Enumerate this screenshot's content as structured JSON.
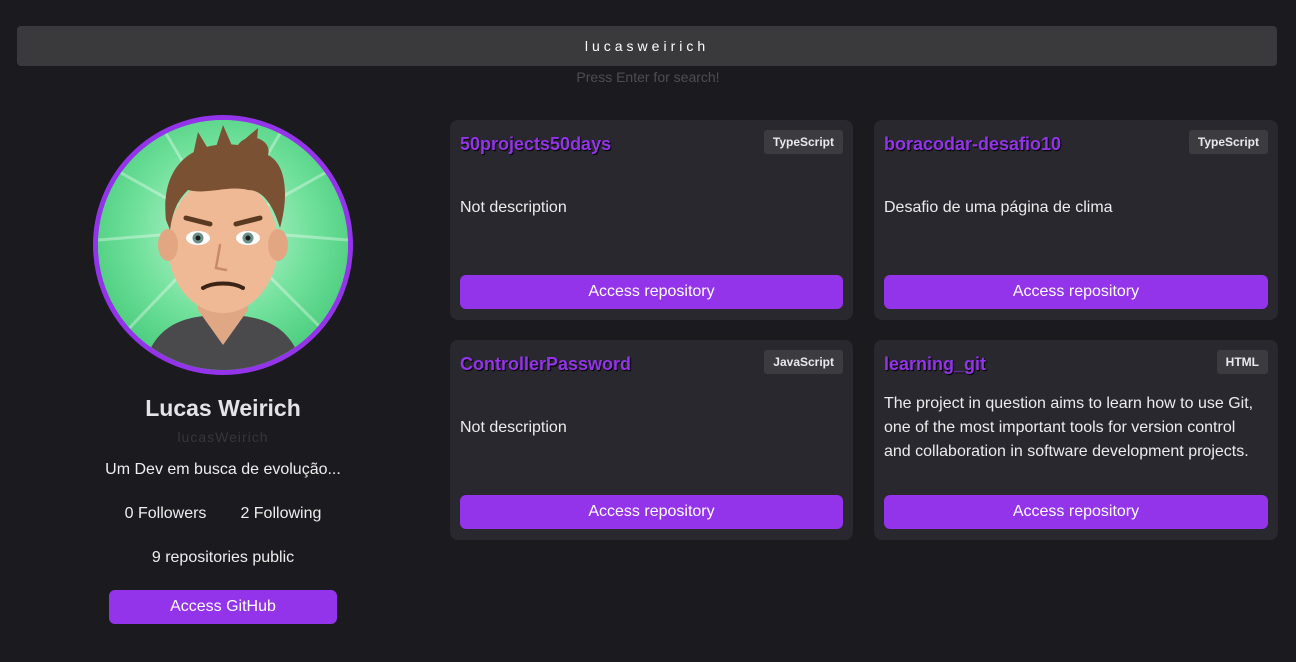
{
  "search": {
    "value": "lucasweirich",
    "hint": "Press Enter for search!"
  },
  "profile": {
    "name": "Lucas Weirich",
    "login": "lucasWeirich",
    "bio": "Um Dev em busca de evolução...",
    "followers": "0 Followers",
    "following": "2 Following",
    "repos": "9 repositories public",
    "button_label": "Access GitHub"
  },
  "repos": [
    {
      "name": "50projects50days",
      "language": "TypeScript",
      "description": "Not description",
      "button_label": "Access repository"
    },
    {
      "name": "boracodar-desafio10",
      "language": "TypeScript",
      "description": "Desafio de uma página de clima",
      "button_label": "Access repository"
    },
    {
      "name": "ControllerPassword",
      "language": "JavaScript",
      "description": "Not description",
      "button_label": "Access repository"
    },
    {
      "name": "learning_git",
      "language": "HTML",
      "description": "The project in question aims to learn how to use Git, one of the most important tools for version control and collaboration in software development projects.",
      "button_label": "Access repository"
    }
  ],
  "colors": {
    "accent": "#9333ea",
    "background": "#1b1a1e",
    "card": "#29282e"
  }
}
